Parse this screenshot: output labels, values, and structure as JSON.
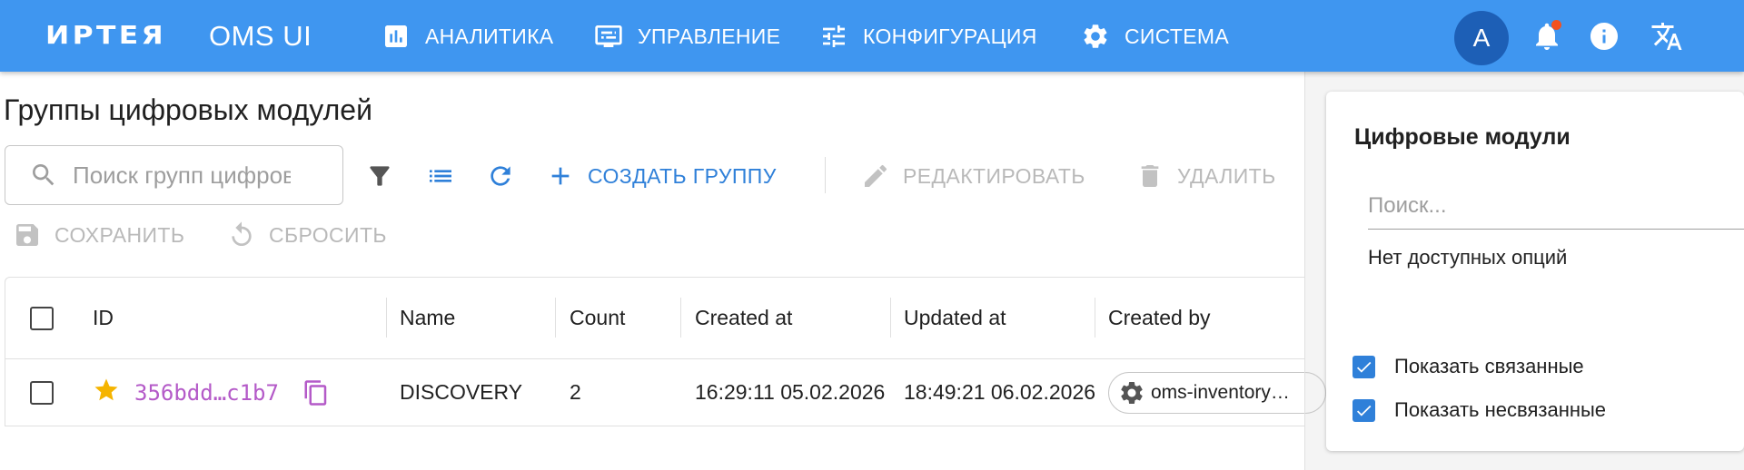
{
  "header": {
    "brand": "ИРТЕЯ",
    "app_name": "OMS UI",
    "nav": [
      {
        "label": "АНАЛИТИКА",
        "icon": "analytics-icon"
      },
      {
        "label": "УПРАВЛЕНИЕ",
        "icon": "management-icon"
      },
      {
        "label": "КОНФИГУРАЦИЯ",
        "icon": "tune-icon"
      },
      {
        "label": "СИСТЕМА",
        "icon": "gear-icon"
      }
    ],
    "avatar_letter": "A",
    "icons": [
      "bell-icon",
      "info-icon",
      "translate-icon"
    ]
  },
  "page": {
    "title": "Группы цифровых модулей",
    "search_placeholder": "Поиск групп цифровых модулей"
  },
  "toolbar": {
    "create_label": "СОЗДАТЬ ГРУППУ",
    "edit_label": "РЕДАКТИРОВАТЬ",
    "delete_label": "УДАЛИТЬ",
    "save_label": "СОХРАНИТЬ",
    "reset_label": "СБРОСИТЬ"
  },
  "table": {
    "columns": [
      "ID",
      "Name",
      "Count",
      "Created at",
      "Updated at",
      "Created by"
    ],
    "rows": [
      {
        "id": "356bdd…c1b7",
        "name": "DISCOVERY",
        "count": "2",
        "created_at": "16:29:11 05.02.2026",
        "updated_at": "18:49:21 06.02.2026",
        "created_by": "oms-inventory…",
        "favorite": true
      }
    ]
  },
  "panel": {
    "title": "Цифровые модули",
    "search_placeholder": "Поиск...",
    "empty_text": "Нет доступных опций",
    "show_linked_label": "Показать связанные",
    "show_linked_checked": true,
    "show_unlinked_label": "Показать несвязанные",
    "show_unlinked_checked": true
  },
  "colors": {
    "header_bg": "#3f96f0",
    "accent": "#2f80d9",
    "id_text": "#b45ac8",
    "star": "#f5b400",
    "avatar_bg": "#1d5fb6"
  }
}
